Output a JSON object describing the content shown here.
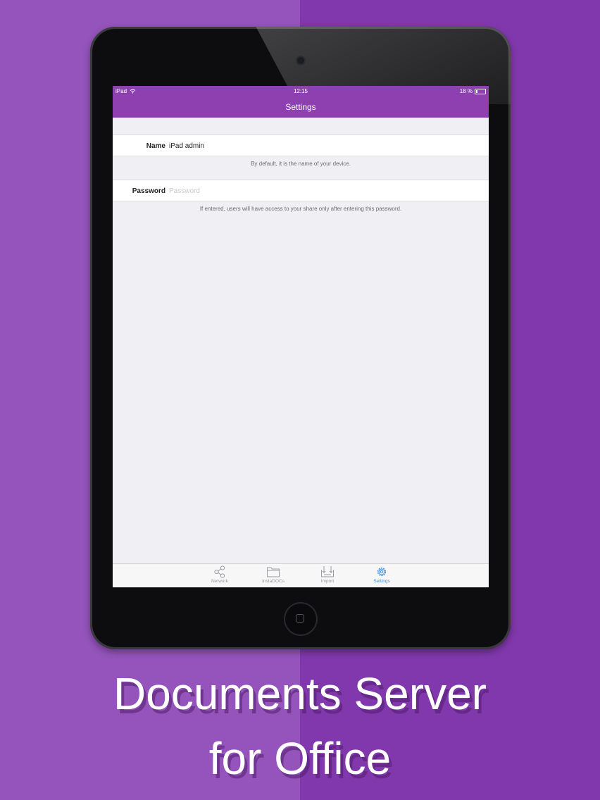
{
  "status_bar": {
    "device": "iPad",
    "time": "12:15",
    "battery_text": "18 %",
    "battery_level": 0.18
  },
  "nav": {
    "title": "Settings"
  },
  "settings": {
    "name_label": "Name",
    "name_value": "iPad admin",
    "name_hint": "By default, it is the name of your device.",
    "password_label": "Password",
    "password_placeholder": "Password",
    "password_hint": "If entered, users will have access to your share only after entering this password."
  },
  "tabs": [
    {
      "label": "Network",
      "icon": "share-icon"
    },
    {
      "label": "InstaDOCs",
      "icon": "folder-icon"
    },
    {
      "label": "Import",
      "icon": "import-tray-icon"
    },
    {
      "label": "Settings",
      "icon": "gear-icon",
      "active": true
    }
  ],
  "caption": {
    "line1": "Documents Server",
    "line2": "for Office"
  },
  "colors": {
    "bg_left": "#9454bb",
    "bg_right": "#8138ac",
    "nav_purple": "#8e3fb0",
    "tab_active": "#3b8de0"
  }
}
